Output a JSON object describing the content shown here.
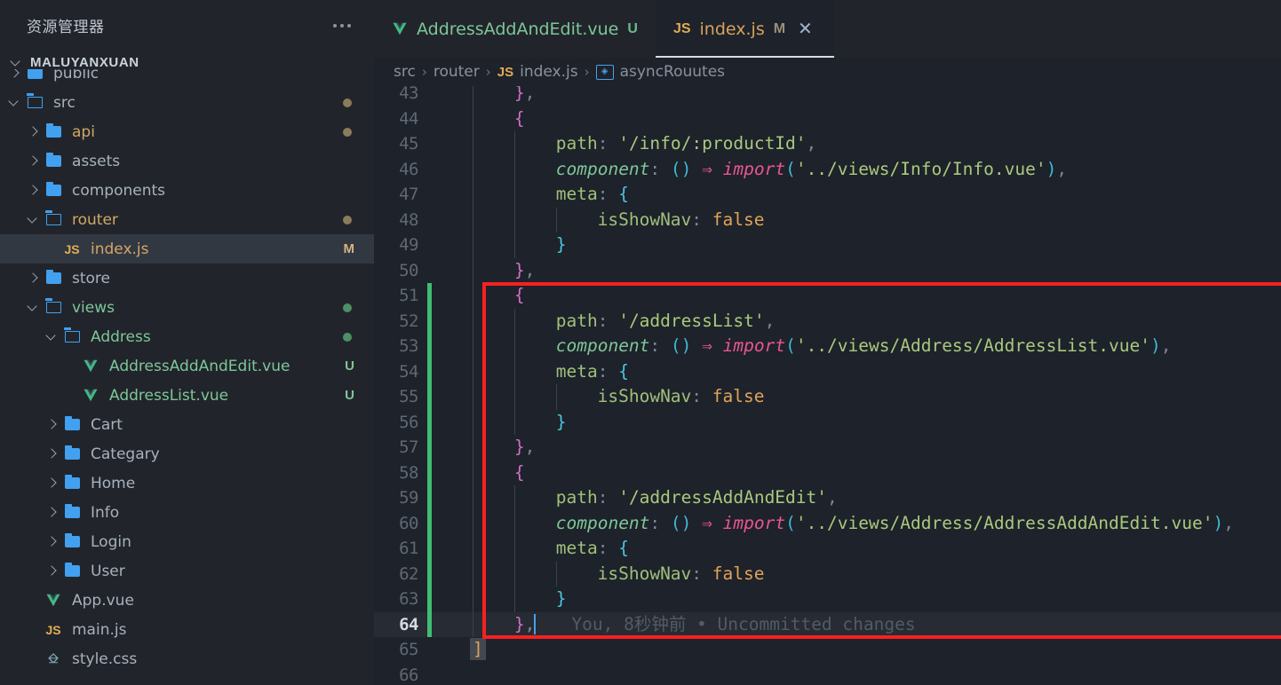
{
  "sidebar": {
    "title": "资源管理器",
    "more_icon": "ellipsis-icon",
    "root_label": "MALUYANXUAN",
    "items": [
      {
        "label": "public",
        "icon": "folder-closed",
        "indent": 1,
        "chev": "right",
        "color": "default",
        "badge": "",
        "dot": ""
      },
      {
        "label": "src",
        "icon": "folder-open",
        "indent": 1,
        "chev": "down",
        "color": "default",
        "badge": "",
        "dot": "brown"
      },
      {
        "label": "api",
        "icon": "folder-closed",
        "indent": 2,
        "chev": "right",
        "color": "amber",
        "badge": "",
        "dot": "brown"
      },
      {
        "label": "assets",
        "icon": "folder-closed",
        "indent": 2,
        "chev": "right",
        "color": "default",
        "badge": "",
        "dot": ""
      },
      {
        "label": "components",
        "icon": "folder-closed",
        "indent": 2,
        "chev": "right",
        "color": "default",
        "badge": "",
        "dot": ""
      },
      {
        "label": "router",
        "icon": "folder-open",
        "indent": 2,
        "chev": "down",
        "color": "amber",
        "badge": "",
        "dot": "brown"
      },
      {
        "label": "index.js",
        "icon": "js",
        "indent": 3,
        "chev": "none",
        "color": "amber",
        "badge": "M",
        "dot": "",
        "selected": true
      },
      {
        "label": "store",
        "icon": "folder-closed",
        "indent": 2,
        "chev": "right",
        "color": "default",
        "badge": "",
        "dot": ""
      },
      {
        "label": "views",
        "icon": "folder-open",
        "indent": 2,
        "chev": "down",
        "color": "green",
        "badge": "",
        "dot": "green"
      },
      {
        "label": "Address",
        "icon": "folder-open",
        "indent": 3,
        "chev": "down",
        "color": "green",
        "badge": "",
        "dot": "green"
      },
      {
        "label": "AddressAddAndEdit.vue",
        "icon": "vue",
        "indent": 4,
        "chev": "none",
        "color": "green",
        "badge": "U",
        "dot": ""
      },
      {
        "label": "AddressList.vue",
        "icon": "vue",
        "indent": 4,
        "chev": "none",
        "color": "green",
        "badge": "U",
        "dot": ""
      },
      {
        "label": "Cart",
        "icon": "folder-closed",
        "indent": 3,
        "chev": "right",
        "color": "default",
        "badge": "",
        "dot": ""
      },
      {
        "label": "Categary",
        "icon": "folder-closed",
        "indent": 3,
        "chev": "right",
        "color": "default",
        "badge": "",
        "dot": ""
      },
      {
        "label": "Home",
        "icon": "folder-closed",
        "indent": 3,
        "chev": "right",
        "color": "default",
        "badge": "",
        "dot": ""
      },
      {
        "label": "Info",
        "icon": "folder-closed",
        "indent": 3,
        "chev": "right",
        "color": "default",
        "badge": "",
        "dot": ""
      },
      {
        "label": "Login",
        "icon": "folder-closed",
        "indent": 3,
        "chev": "right",
        "color": "default",
        "badge": "",
        "dot": ""
      },
      {
        "label": "User",
        "icon": "folder-closed",
        "indent": 3,
        "chev": "right",
        "color": "default",
        "badge": "",
        "dot": ""
      },
      {
        "label": "App.vue",
        "icon": "vue",
        "indent": 2,
        "chev": "none",
        "color": "default",
        "badge": "",
        "dot": ""
      },
      {
        "label": "main.js",
        "icon": "js",
        "indent": 2,
        "chev": "none",
        "color": "default",
        "badge": "",
        "dot": ""
      },
      {
        "label": "style.css",
        "icon": "css",
        "indent": 2,
        "chev": "none",
        "color": "default",
        "badge": "",
        "dot": ""
      }
    ]
  },
  "tabs": [
    {
      "name": "AddressAddAndEdit.vue",
      "icon": "vue-icon",
      "badge": "U",
      "kind": "vue",
      "active": false,
      "closable": false
    },
    {
      "name": "index.js",
      "icon": "js-icon",
      "badge": "M",
      "kind": "jsf",
      "active": true,
      "closable": true,
      "close_icon": "close-icon"
    }
  ],
  "breadcrumb": {
    "items": [
      {
        "text": "src",
        "icon": ""
      },
      {
        "text": "router",
        "icon": ""
      },
      {
        "text": "index.js",
        "icon": "js-icon"
      },
      {
        "text": "asyncRouutes",
        "icon": "symbol-variable-icon"
      }
    ],
    "separator": "›"
  },
  "editor": {
    "first_visible_line": 42,
    "active_line": 64,
    "cursor_line": 64,
    "blame_annotation": "You, 8秒钟前 • Uncommitted changes",
    "lines": [
      {
        "n": 43,
        "indent": 1,
        "git": "",
        "tokens": [
          {
            "t": "}",
            "c": "t-brace"
          },
          {
            "t": ",",
            "c": "t-punc"
          }
        ]
      },
      {
        "n": 44,
        "indent": 1,
        "git": "",
        "tokens": [
          {
            "t": "{",
            "c": "t-brace"
          }
        ]
      },
      {
        "n": 45,
        "indent": 2,
        "git": "",
        "tokens": [
          {
            "t": "path",
            "c": "t-key"
          },
          {
            "t": ": ",
            "c": "t-punc"
          },
          {
            "t": "'/info/:productId'",
            "c": "t-str"
          },
          {
            "t": ",",
            "c": "t-punc"
          }
        ]
      },
      {
        "n": 46,
        "indent": 2,
        "git": "",
        "tokens": [
          {
            "t": "component",
            "c": "t-keyi"
          },
          {
            "t": ": ",
            "c": "t-punc"
          },
          {
            "t": "()",
            "c": "t-paren"
          },
          {
            "t": " ⇒ ",
            "c": "t-arrow"
          },
          {
            "t": "import",
            "c": "t-import"
          },
          {
            "t": "(",
            "c": "t-paren"
          },
          {
            "t": "'../views/Info/Info.vue'",
            "c": "t-str"
          },
          {
            "t": ")",
            "c": "t-paren"
          },
          {
            "t": ",",
            "c": "t-punc"
          }
        ]
      },
      {
        "n": 47,
        "indent": 2,
        "git": "",
        "tokens": [
          {
            "t": "meta",
            "c": "t-key"
          },
          {
            "t": ": ",
            "c": "t-punc"
          },
          {
            "t": "{",
            "c": "t-brace2"
          }
        ]
      },
      {
        "n": 48,
        "indent": 3,
        "git": "",
        "tokens": [
          {
            "t": "isShowNav",
            "c": "t-key"
          },
          {
            "t": ": ",
            "c": "t-punc"
          },
          {
            "t": "false",
            "c": "t-bool"
          }
        ]
      },
      {
        "n": 49,
        "indent": 2,
        "git": "",
        "tokens": [
          {
            "t": "}",
            "c": "t-brace2"
          }
        ]
      },
      {
        "n": 50,
        "indent": 1,
        "git": "",
        "tokens": [
          {
            "t": "}",
            "c": "t-brace"
          },
          {
            "t": ",",
            "c": "t-punc"
          }
        ]
      },
      {
        "n": 51,
        "indent": 1,
        "git": "added",
        "tokens": [
          {
            "t": "{",
            "c": "t-brace"
          }
        ]
      },
      {
        "n": 52,
        "indent": 2,
        "git": "added",
        "tokens": [
          {
            "t": "path",
            "c": "t-key"
          },
          {
            "t": ": ",
            "c": "t-punc"
          },
          {
            "t": "'/addressList'",
            "c": "t-str"
          },
          {
            "t": ",",
            "c": "t-punc"
          }
        ]
      },
      {
        "n": 53,
        "indent": 2,
        "git": "added",
        "tokens": [
          {
            "t": "component",
            "c": "t-keyi"
          },
          {
            "t": ": ",
            "c": "t-punc"
          },
          {
            "t": "()",
            "c": "t-paren"
          },
          {
            "t": " ⇒ ",
            "c": "t-arrow"
          },
          {
            "t": "import",
            "c": "t-import"
          },
          {
            "t": "(",
            "c": "t-paren"
          },
          {
            "t": "'../views/Address/AddressList.vue'",
            "c": "t-str"
          },
          {
            "t": ")",
            "c": "t-paren"
          },
          {
            "t": ",",
            "c": "t-punc"
          }
        ]
      },
      {
        "n": 54,
        "indent": 2,
        "git": "added",
        "tokens": [
          {
            "t": "meta",
            "c": "t-key"
          },
          {
            "t": ": ",
            "c": "t-punc"
          },
          {
            "t": "{",
            "c": "t-brace2"
          }
        ]
      },
      {
        "n": 55,
        "indent": 3,
        "git": "added",
        "tokens": [
          {
            "t": "isShowNav",
            "c": "t-key"
          },
          {
            "t": ": ",
            "c": "t-punc"
          },
          {
            "t": "false",
            "c": "t-bool"
          }
        ]
      },
      {
        "n": 56,
        "indent": 2,
        "git": "added",
        "tokens": [
          {
            "t": "}",
            "c": "t-brace2"
          }
        ]
      },
      {
        "n": 57,
        "indent": 1,
        "git": "added",
        "tokens": [
          {
            "t": "}",
            "c": "t-brace"
          },
          {
            "t": ",",
            "c": "t-punc"
          }
        ]
      },
      {
        "n": 58,
        "indent": 1,
        "git": "added",
        "tokens": [
          {
            "t": "{",
            "c": "t-brace"
          }
        ]
      },
      {
        "n": 59,
        "indent": 2,
        "git": "added",
        "tokens": [
          {
            "t": "path",
            "c": "t-key"
          },
          {
            "t": ": ",
            "c": "t-punc"
          },
          {
            "t": "'/addressAddAndEdit'",
            "c": "t-str"
          },
          {
            "t": ",",
            "c": "t-punc"
          }
        ]
      },
      {
        "n": 60,
        "indent": 2,
        "git": "added",
        "tokens": [
          {
            "t": "component",
            "c": "t-keyi"
          },
          {
            "t": ": ",
            "c": "t-punc"
          },
          {
            "t": "()",
            "c": "t-paren"
          },
          {
            "t": " ⇒ ",
            "c": "t-arrow"
          },
          {
            "t": "import",
            "c": "t-import"
          },
          {
            "t": "(",
            "c": "t-paren"
          },
          {
            "t": "'../views/Address/AddressAddAndEdit.vue'",
            "c": "t-str"
          },
          {
            "t": ")",
            "c": "t-paren"
          },
          {
            "t": ",",
            "c": "t-punc"
          }
        ]
      },
      {
        "n": 61,
        "indent": 2,
        "git": "added",
        "tokens": [
          {
            "t": "meta",
            "c": "t-key"
          },
          {
            "t": ": ",
            "c": "t-punc"
          },
          {
            "t": "{",
            "c": "t-brace2"
          }
        ]
      },
      {
        "n": 62,
        "indent": 3,
        "git": "added",
        "tokens": [
          {
            "t": "isShowNav",
            "c": "t-key"
          },
          {
            "t": ": ",
            "c": "t-punc"
          },
          {
            "t": "false",
            "c": "t-bool"
          }
        ]
      },
      {
        "n": 63,
        "indent": 2,
        "git": "added",
        "tokens": [
          {
            "t": "}",
            "c": "t-brace2"
          }
        ]
      },
      {
        "n": 64,
        "indent": 1,
        "git": "added",
        "active": true,
        "cursor": true,
        "blame": true,
        "tokens": [
          {
            "t": "}",
            "c": "t-brace"
          },
          {
            "t": ",",
            "c": "t-punc"
          }
        ]
      },
      {
        "n": 65,
        "indent": 0,
        "git": "",
        "tokens": [
          {
            "t": "]",
            "c": "t-brace3",
            "hl": true
          }
        ]
      },
      {
        "n": 66,
        "indent": 0,
        "git": "",
        "tokens": []
      }
    ]
  },
  "annotation": {
    "type": "red-rectangle-highlight",
    "color": "#f82020"
  }
}
